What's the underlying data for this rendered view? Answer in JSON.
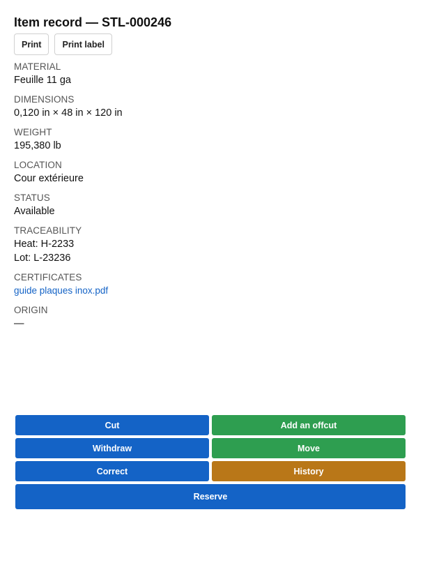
{
  "header": {
    "title": "Item record — STL-000246",
    "print_label": "Print",
    "print_tag_label": "Print label"
  },
  "fields": {
    "material": {
      "label": "MATERIAL",
      "value": "Feuille 11 ga"
    },
    "dimensions": {
      "label": "DIMENSIONS",
      "value": "0,120 in × 48 in × 120 in"
    },
    "weight": {
      "label": "WEIGHT",
      "value": "195,380 lb"
    },
    "location": {
      "label": "LOCATION",
      "value": "Cour extérieure"
    },
    "status": {
      "label": "STATUS",
      "value": "Available"
    },
    "traceability": {
      "label": "TRACEABILITY",
      "heat": "Heat: H-2233",
      "lot": "Lot: L-23236"
    },
    "certificates": {
      "label": "CERTIFICATES",
      "link": "guide plaques inox.pdf"
    },
    "origin": {
      "label": "ORIGIN",
      "value": "—"
    }
  },
  "actions": {
    "cut": "Cut",
    "add_offcut": "Add an offcut",
    "withdraw": "Withdraw",
    "move": "Move",
    "correct": "Correct",
    "history": "History",
    "reserve": "Reserve"
  },
  "colors": {
    "primary_blue": "#1463c6",
    "success_green": "#2e9e50",
    "history_orange": "#b97718",
    "link_blue": "#1463c6"
  }
}
